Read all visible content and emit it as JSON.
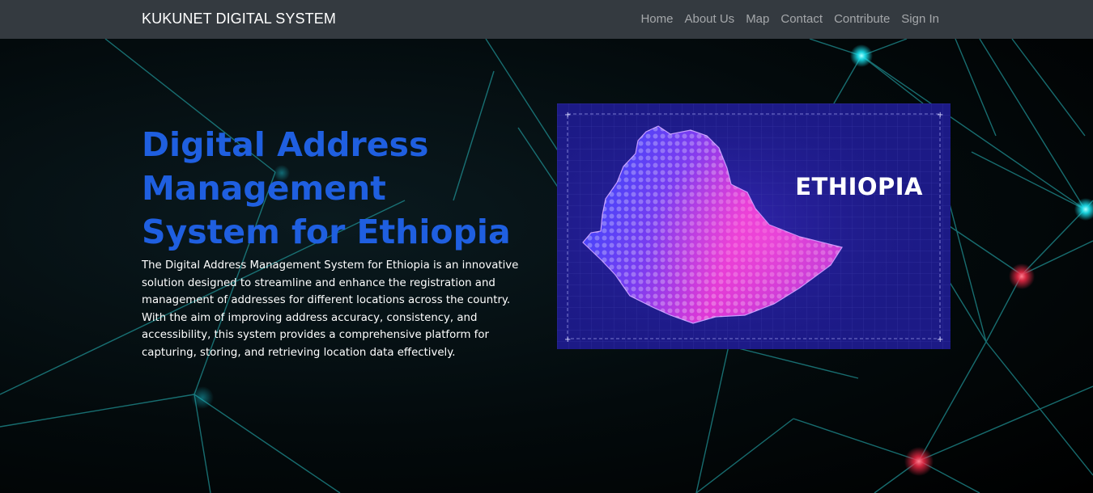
{
  "navbar": {
    "brand": "KUKUNET DIGITAL SYSTEM",
    "links": [
      {
        "label": "Home"
      },
      {
        "label": "About Us"
      },
      {
        "label": "Map"
      },
      {
        "label": "Contact"
      },
      {
        "label": "Contribute"
      },
      {
        "label": "Sign In"
      }
    ]
  },
  "hero": {
    "title": "Digital Address Management System for Ethiopia",
    "description": "The Digital Address Management System for Ethiopia is an innovative solution designed to streamline and enhance the registration and management of addresses for different locations across the country. With the aim of improving address accuracy, consistency, and accessibility, this system provides a comprehensive platform for capturing, storing, and retrieving location data effectively.",
    "image": {
      "label": "ETHIOPIA",
      "icon": "ethiopia-map-illustration"
    }
  },
  "colors": {
    "navbar_bg": "#343a40",
    "title": "#1f5fe0",
    "card_bg": "#1c1a86",
    "network_line": "#1f8f92",
    "node_cyan": "#19e3f0",
    "node_red": "#ff2b4a"
  }
}
